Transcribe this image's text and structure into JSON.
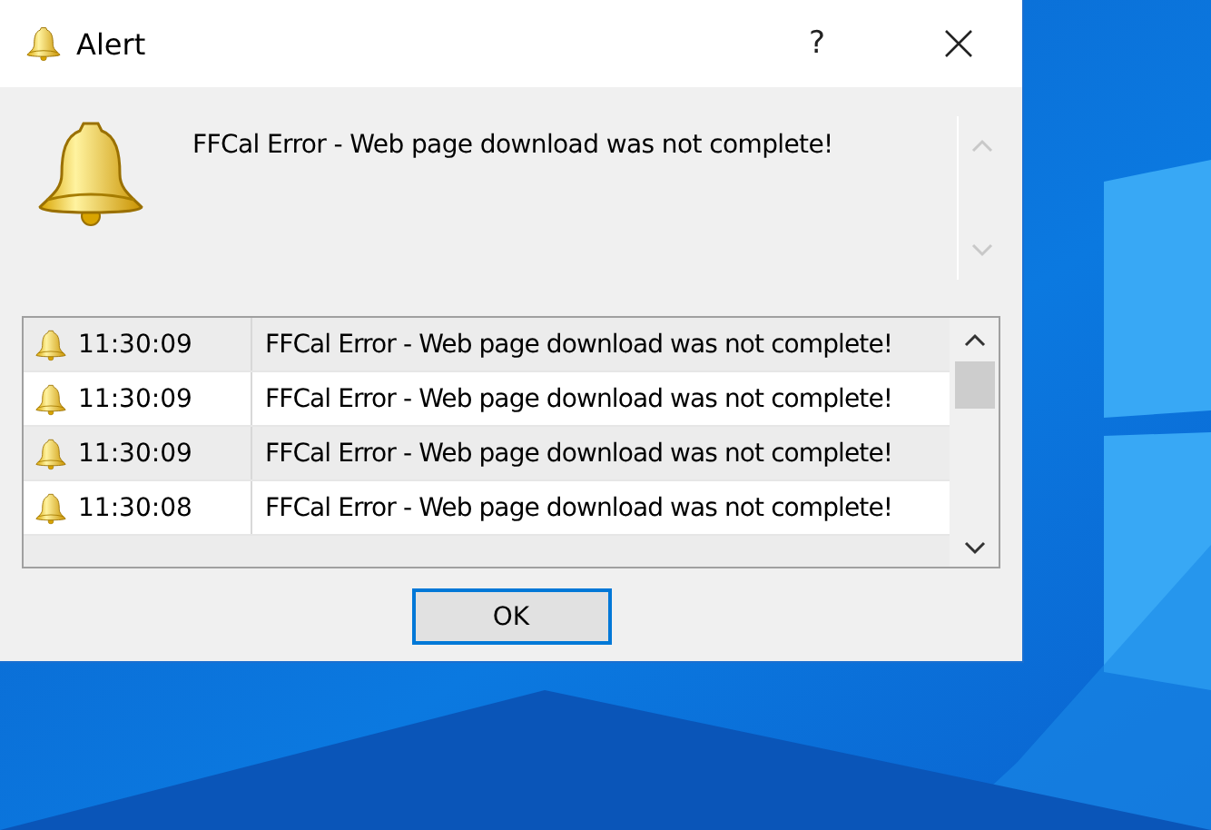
{
  "window": {
    "title": "Alert",
    "help_glyph": "?"
  },
  "message": "FFCal Error - Web page download was not complete!",
  "log": [
    {
      "time": "11:30:09",
      "message": "FFCal Error - Web page download was not complete!"
    },
    {
      "time": "11:30:09",
      "message": "FFCal Error - Web page download was not complete!"
    },
    {
      "time": "11:30:09",
      "message": "FFCal Error - Web page download was not complete!"
    },
    {
      "time": "11:30:08",
      "message": "FFCal Error - Web page download was not complete!"
    }
  ],
  "buttons": [
    "OK"
  ]
}
